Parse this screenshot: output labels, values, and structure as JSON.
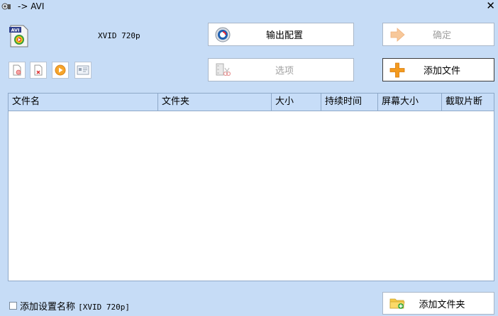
{
  "window": {
    "title": "-> AVI",
    "close_glyph": "✕"
  },
  "profile": {
    "name": "XVID 720p",
    "icon": "avi-file-icon"
  },
  "buttons": {
    "output_config": "输出配置",
    "confirm": "确定",
    "options": "选项",
    "add_file": "添加文件",
    "add_folder": "添加文件夹"
  },
  "small_buttons": [
    "remove-file-icon",
    "clear-list-icon",
    "play-icon",
    "media-info-icon"
  ],
  "table": {
    "columns": [
      "文件名",
      "文件夹",
      "大小",
      "持续时间",
      "屏幕大小",
      "截取片断"
    ],
    "rows": []
  },
  "footer": {
    "checkbox_label": "添加设置名称",
    "checkbox_value": "[XVID 720p]",
    "checked": false
  },
  "colors": {
    "background": "#c6dcf6",
    "header": "#c7ddf8",
    "plus_orange": "#f39a1f"
  }
}
